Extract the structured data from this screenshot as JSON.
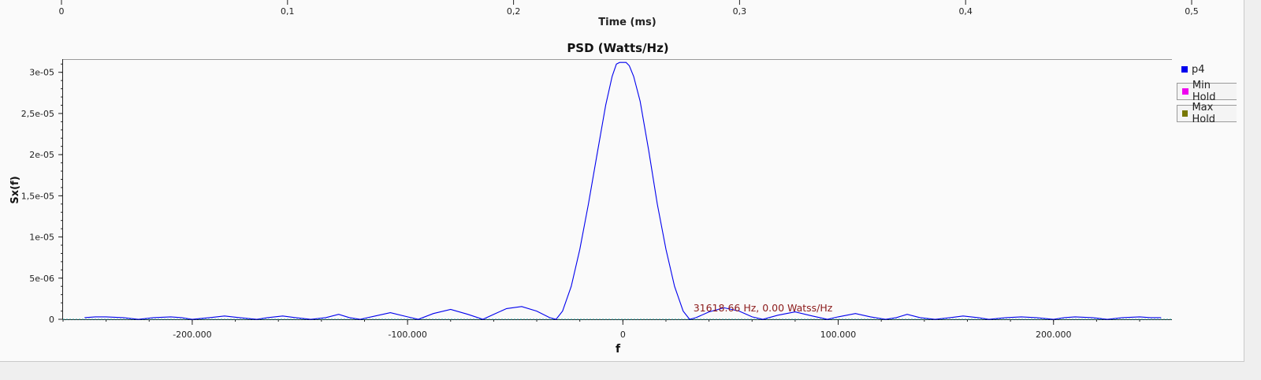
{
  "top_axis": {
    "label": "Time (ms)",
    "ticks": [
      "0",
      "0,1",
      "0,2",
      "0,3",
      "0,4",
      "0,5"
    ],
    "tick_values": [
      0,
      0.1,
      0.2,
      0.3,
      0.4,
      0.5
    ],
    "range": [
      0,
      0.5
    ]
  },
  "chart_data": {
    "type": "line",
    "title": "PSD (Watts/Hz)",
    "xlabel": "f",
    "ylabel": "Sx(f)",
    "xlim": [
      -260000,
      255000
    ],
    "ylim": [
      0,
      3.16e-05
    ],
    "x_ticks": [
      -200000,
      -100000,
      0,
      100000,
      200000
    ],
    "x_tick_labels": [
      "-200.000",
      "-100.000",
      "0",
      "100.000",
      "200.000"
    ],
    "y_ticks": [
      0,
      5e-06,
      1e-05,
      1.5e-05,
      2e-05,
      2.5e-05,
      3e-05
    ],
    "y_tick_labels": [
      "0",
      "5e-06",
      "1e-05",
      "1,5e-05",
      "2e-05",
      "2,5e-05",
      "3e-05"
    ],
    "grid": false,
    "legend_position": "right",
    "series": [
      {
        "name": "p4",
        "color": "#0000ee",
        "x": [
          -250000,
          -245000,
          -240000,
          -232000,
          -225000,
          -218000,
          -210000,
          -205000,
          -200000,
          -192000,
          -185000,
          -178000,
          -170000,
          -165000,
          -158000,
          -152000,
          -145000,
          -138000,
          -132000,
          -127000,
          -122000,
          -115000,
          -108000,
          -100000,
          -95000,
          -88000,
          -80000,
          -72000,
          -65000,
          -60000,
          -54000,
          -47000,
          -40000,
          -34000,
          -31000,
          -28000,
          -24000,
          -20000,
          -16000,
          -12000,
          -8000,
          -5000,
          -3000,
          -1500,
          0,
          1500,
          3000,
          5000,
          8000,
          12000,
          16000,
          20000,
          24000,
          28000,
          31000,
          34000,
          40000,
          47000,
          54000,
          60000,
          65000,
          72000,
          80000,
          88000,
          95000,
          100000,
          108000,
          115000,
          122000,
          127000,
          132000,
          138000,
          145000,
          152000,
          158000,
          165000,
          170000,
          178000,
          185000,
          192000,
          200000,
          205000,
          210000,
          218000,
          225000,
          232000,
          240000,
          245000,
          250000
        ],
        "y": [
          2e-07,
          3e-07,
          3e-07,
          2e-07,
          0,
          2e-07,
          3e-07,
          2e-07,
          0,
          2e-07,
          4e-07,
          2e-07,
          0,
          2e-07,
          4e-07,
          2e-07,
          0,
          2e-07,
          6e-07,
          2e-07,
          0,
          4e-07,
          8e-07,
          3e-07,
          0,
          7e-07,
          1.2e-06,
          6e-07,
          0,
          6e-07,
          1.3e-06,
          1.55e-06,
          1e-06,
          2e-07,
          0,
          1e-06,
          4e-06,
          8.5e-06,
          1.4e-05,
          2e-05,
          2.6e-05,
          2.95e-05,
          3.1e-05,
          3.12e-05,
          3.12e-05,
          3.12e-05,
          3.08e-05,
          2.95e-05,
          2.65e-05,
          2.05e-05,
          1.4e-05,
          8.5e-06,
          4e-06,
          1e-06,
          0,
          2e-07,
          9e-07,
          1.4e-06,
          1e-06,
          3e-07,
          0,
          5e-07,
          9e-07,
          4e-07,
          0,
          3e-07,
          7e-07,
          3e-07,
          0,
          2e-07,
          6e-07,
          2e-07,
          0,
          2e-07,
          4e-07,
          2e-07,
          0,
          2e-07,
          3e-07,
          2e-07,
          0,
          2e-07,
          3e-07,
          2e-07,
          0,
          2e-07,
          3e-07,
          2e-07,
          2e-07
        ]
      },
      {
        "name": "Min Hold",
        "color": "#ee00ee"
      },
      {
        "name": "Max Hold",
        "color": "#777700"
      }
    ],
    "baseline_color": "#20a0a0",
    "annotation": {
      "text": "31618.66 Hz, 0.00 Watss/Hz",
      "x": 31618.66,
      "y": 0,
      "color": "#8b1a1a"
    }
  },
  "legend": [
    {
      "label": "p4",
      "color": "#0000ee",
      "boxed": false
    },
    {
      "label": "Min Hold",
      "color": "#ee00ee",
      "boxed": true
    },
    {
      "label": "Max Hold",
      "color": "#777700",
      "boxed": true
    }
  ]
}
